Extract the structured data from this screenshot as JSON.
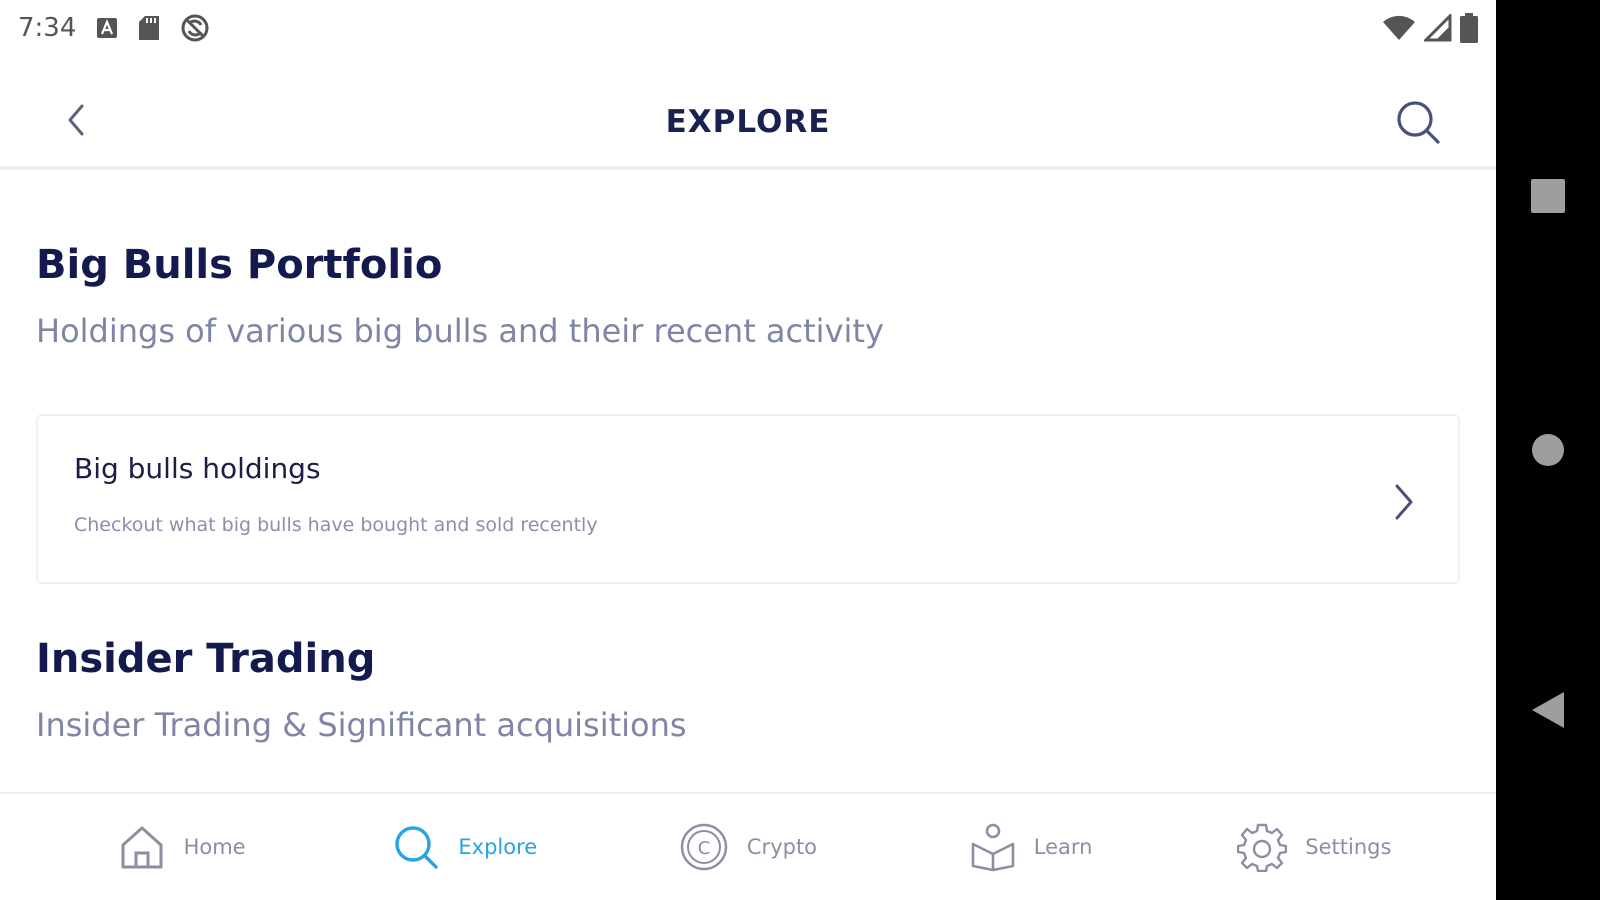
{
  "status_bar": {
    "time": "7:34",
    "icons": [
      "a-notification-icon",
      "sd-card-icon",
      "sync-disabled-icon"
    ],
    "right_icons": [
      "wifi-icon",
      "signal-icon",
      "battery-icon"
    ]
  },
  "header": {
    "title": "EXPLORE",
    "back_icon": "chevron-left-icon",
    "search_icon": "search-icon"
  },
  "sections": [
    {
      "title": "Big Bulls Portfolio",
      "subtitle": "Holdings of various big bulls and their recent activity",
      "cards": [
        {
          "title": "Big bulls holdings",
          "description": "Checkout what big bulls have bought and sold recently"
        }
      ]
    },
    {
      "title": "Insider Trading",
      "subtitle": "Insider Trading & Significant acquisitions"
    }
  ],
  "bottom_nav": {
    "items": [
      {
        "label": "Home",
        "icon": "home-icon",
        "active": false
      },
      {
        "label": "Explore",
        "icon": "search-icon",
        "active": true
      },
      {
        "label": "Crypto",
        "icon": "crypto-coin-icon",
        "active": false
      },
      {
        "label": "Learn",
        "icon": "learn-book-icon",
        "active": false
      },
      {
        "label": "Settings",
        "icon": "gear-icon",
        "active": false
      }
    ]
  },
  "colors": {
    "title": "#141a4d",
    "subtitle": "#7e86a6",
    "active": "#27a3e6",
    "inactive": "#8a8fa3"
  }
}
